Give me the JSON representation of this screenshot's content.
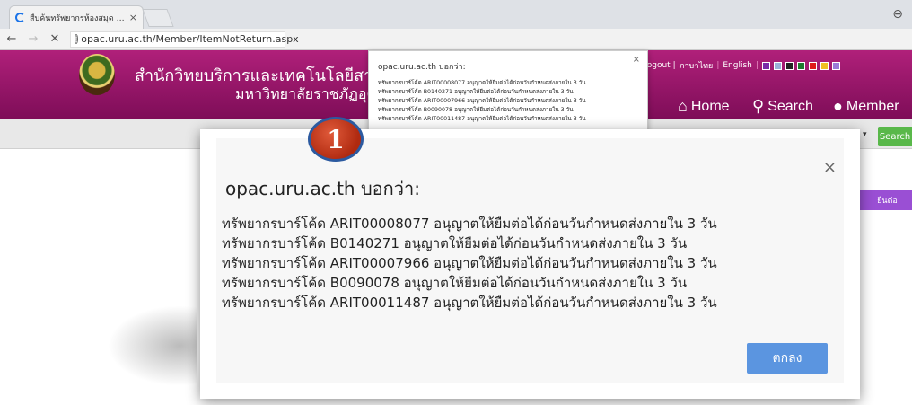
{
  "browser": {
    "tab_title": "สืบค้นทรัพยากรห้องสมุด - สำ",
    "tab_close": "×",
    "profile_icon": "user-circle-icon",
    "back": "←",
    "forward": "→",
    "stop": "✕",
    "url": "opac.uru.ac.th/Member/ItemNotReturn.aspx"
  },
  "site": {
    "title_line1": "สำนักวิทยบริการและเทคโนโลยีสารสนเ",
    "title_line2": "มหาวิทยาลัยราชภัฏอุตรดิ",
    "top_links": {
      "logout": "| Logout |",
      "thai": "ภาษาไทย",
      "sep": "|",
      "english": "English",
      "sep2": "|"
    },
    "color_swatches": [
      "#7a2aa8",
      "#9ab0d8",
      "#222222",
      "#1e7a2e",
      "#e01a1a",
      "#f0c020",
      "#9a7ad8"
    ],
    "menu": {
      "home": "Home",
      "search": "Search",
      "member": "Member"
    },
    "search_button": "Search",
    "dropdown_arrow": "▾",
    "purple_tab": {
      "left": "ง",
      "right": "ยืนต่อ"
    }
  },
  "small_alert": {
    "title": "opac.uru.ac.th บอกว่า:",
    "close": "×",
    "lines": [
      "ทรัพยากรบาร์โค้ด ARIT00008077 อนุญาตให้ยืมต่อได้ก่อนวันกำหนดส่งภายใน 3 วัน",
      "ทรัพยากรบาร์โค้ด B0140271 อนุญาตให้ยืมต่อได้ก่อนวันกำหนดส่งภายใน 3 วัน",
      "ทรัพยากรบาร์โค้ด ARIT00007966 อนุญาตให้ยืมต่อได้ก่อนวันกำหนดส่งภายใน 3 วัน",
      "ทรัพยากรบาร์โค้ด B0090078 อนุญาตให้ยืมต่อได้ก่อนวันกำหนดส่งภายใน 3 วัน",
      "ทรัพยากรบาร์โค้ด ARIT00011487 อนุญาตให้ยืมต่อได้ก่อนวันกำหนดส่งภายใน 3 วัน"
    ]
  },
  "dialog": {
    "step_number": "1",
    "title": "opac.uru.ac.th บอกว่า:",
    "close": "×",
    "lines": [
      "ทรัพยากรบาร์โค้ด ARIT00008077 อนุญาตให้ยืมต่อได้ก่อนวันกำหนดส่งภายใน 3 วัน",
      "ทรัพยากรบาร์โค้ด B0140271 อนุญาตให้ยืมต่อได้ก่อนวันกำหนดส่งภายใน 3 วัน",
      "ทรัพยากรบาร์โค้ด ARIT00007966 อนุญาตให้ยืมต่อได้ก่อนวันกำหนดส่งภายใน 3 วัน",
      "ทรัพยากรบาร์โค้ด B0090078 อนุญาตให้ยืมต่อได้ก่อนวันกำหนดส่งภายใน 3 วัน",
      "ทรัพยากรบาร์โค้ด ARIT00011487 อนุญาตให้ยืมต่อได้ก่อนวันกำหนดส่งภายใน 3 วัน"
    ],
    "ok_label": "ตกลง",
    "ok_color": "#5b95e0"
  }
}
